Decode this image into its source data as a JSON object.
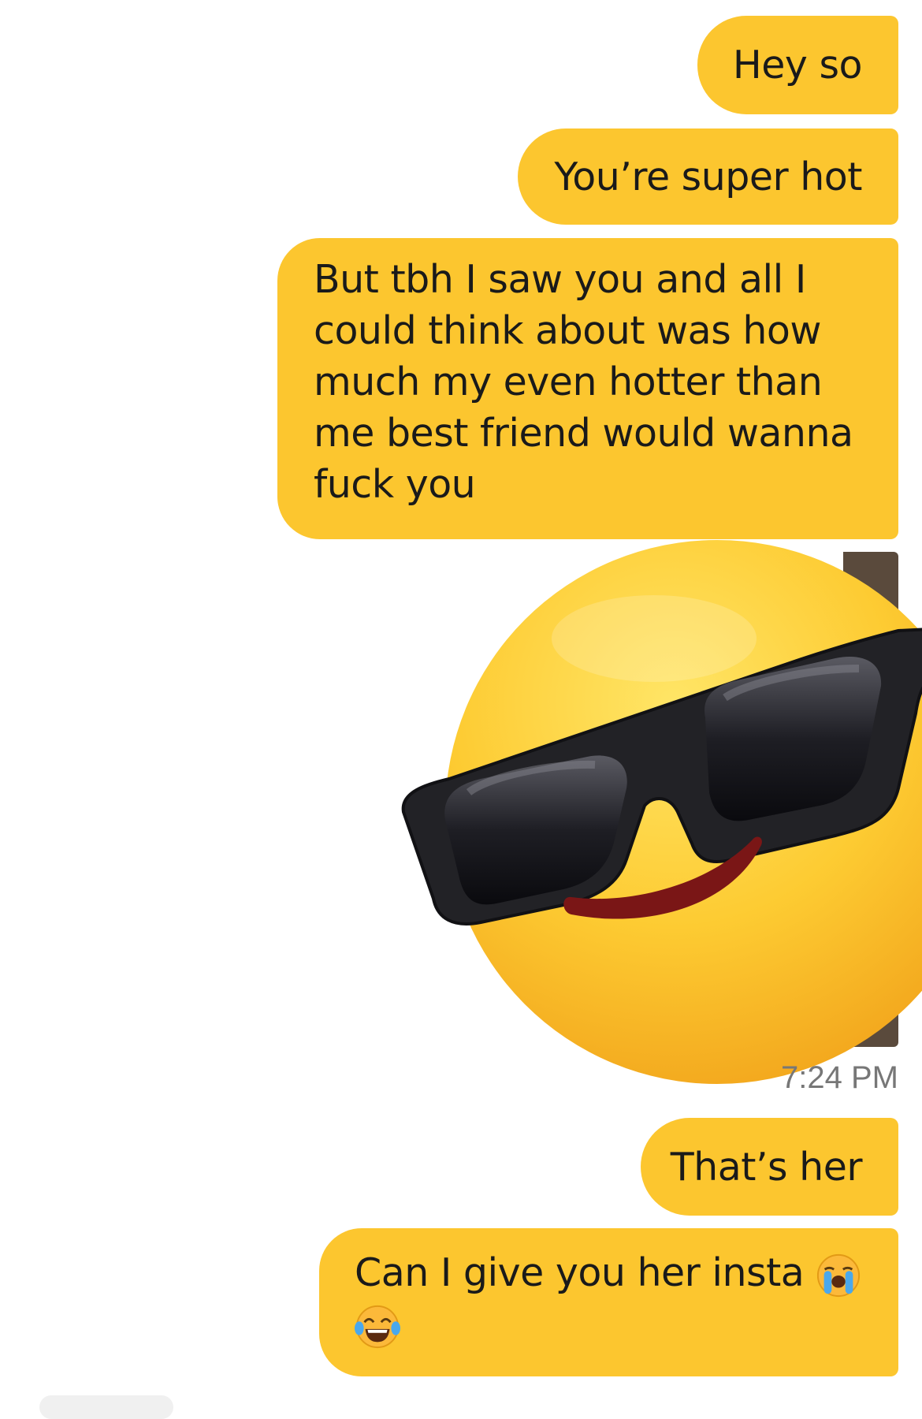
{
  "chat": {
    "messages": [
      {
        "text": "Hey so"
      },
      {
        "text": "You’re super hot"
      },
      {
        "lines": [
          "But tbh I saw you and all I",
          "could think about was how",
          "much my even hotter than",
          "me best friend would wanna",
          "fuck you"
        ]
      },
      {
        "sticker": "smiling-face-with-sunglasses"
      },
      {
        "text": "That’s her"
      },
      {
        "text": "Can I give you her insta",
        "emojis": [
          "loudly-crying-face",
          "face-with-tears-of-joy"
        ]
      }
    ],
    "timestamp": "7:24 PM"
  },
  "colors": {
    "bubble": "#fcc62f",
    "background": "#ffffff",
    "text": "#1a1a1a",
    "timestamp": "#777777"
  }
}
